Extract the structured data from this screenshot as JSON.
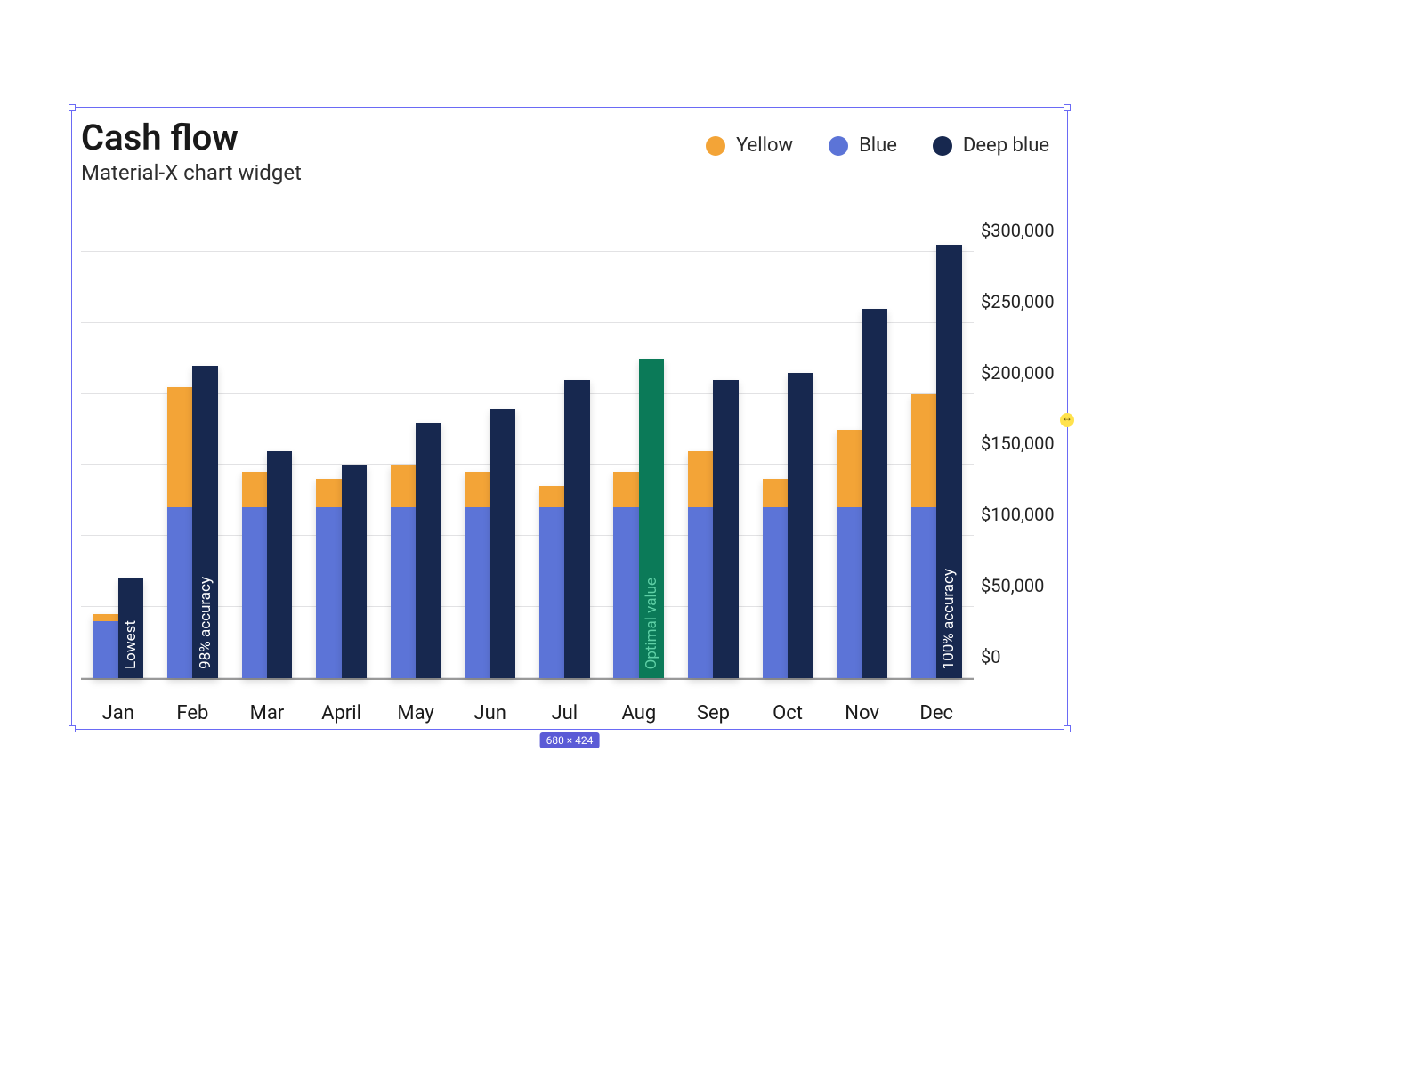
{
  "title": "Cash flow",
  "subtitle": "Material-X chart widget",
  "size_badge": "680 × 424",
  "legend": [
    {
      "label": "Yellow",
      "color": "#f3a437"
    },
    {
      "label": "Blue",
      "color": "#5c74d7"
    },
    {
      "label": "Deep blue",
      "color": "#17284f"
    }
  ],
  "y_ticks": [
    "$0",
    "$50,000",
    "$100,000",
    "$150,000",
    "$200,000",
    "$250,000",
    "$300,000"
  ],
  "annotations": {
    "jan_deep": {
      "text": "Lowest",
      "color": "#ffffff"
    },
    "feb_deep": {
      "text": "98% accuracy",
      "color": "#ffffff"
    },
    "aug_deep": {
      "text": "Optimal value",
      "color": "#5fd0a6"
    },
    "dec_deep": {
      "text": "100% accuracy",
      "color": "#ffffff"
    }
  },
  "colors": {
    "yellow": "#f3a437",
    "blue": "#5c74d7",
    "deep": "#17284f",
    "optimal": "#0b7a58"
  },
  "chart_data": {
    "type": "bar",
    "title": "Cash flow",
    "subtitle": "Material-X chart widget",
    "ylabel": "",
    "xlabel": "",
    "ylim": [
      0,
      320000
    ],
    "y_ticks": [
      0,
      50000,
      100000,
      150000,
      200000,
      250000,
      300000
    ],
    "categories": [
      "Jan",
      "Feb",
      "Mar",
      "April",
      "May",
      "Jun",
      "Jul",
      "Aug",
      "Sep",
      "Oct",
      "Nov",
      "Dec"
    ],
    "legend": [
      "Yellow",
      "Blue",
      "Deep blue"
    ],
    "series": [
      {
        "name": "Blue",
        "values": [
          40000,
          120000,
          120000,
          120000,
          120000,
          120000,
          120000,
          120000,
          120000,
          120000,
          120000,
          120000
        ]
      },
      {
        "name": "Yellow",
        "values": [
          45000,
          205000,
          145000,
          140000,
          150000,
          145000,
          135000,
          145000,
          160000,
          140000,
          175000,
          200000
        ],
        "note": "Yellow bar top value; drawn stacked on top of Blue segment"
      },
      {
        "name": "Deep blue",
        "values": [
          70000,
          220000,
          160000,
          150000,
          180000,
          190000,
          210000,
          225000,
          210000,
          215000,
          260000,
          305000
        ]
      }
    ],
    "bar_annotations": [
      {
        "category": "Jan",
        "series": "Deep blue",
        "text": "Lowest"
      },
      {
        "category": "Feb",
        "series": "Deep blue",
        "text": "98% accuracy"
      },
      {
        "category": "Aug",
        "series": "Deep blue",
        "text": "Optimal value",
        "bar_color_override": "#0b7a58"
      },
      {
        "category": "Dec",
        "series": "Deep blue",
        "text": "100% accuracy"
      }
    ]
  }
}
